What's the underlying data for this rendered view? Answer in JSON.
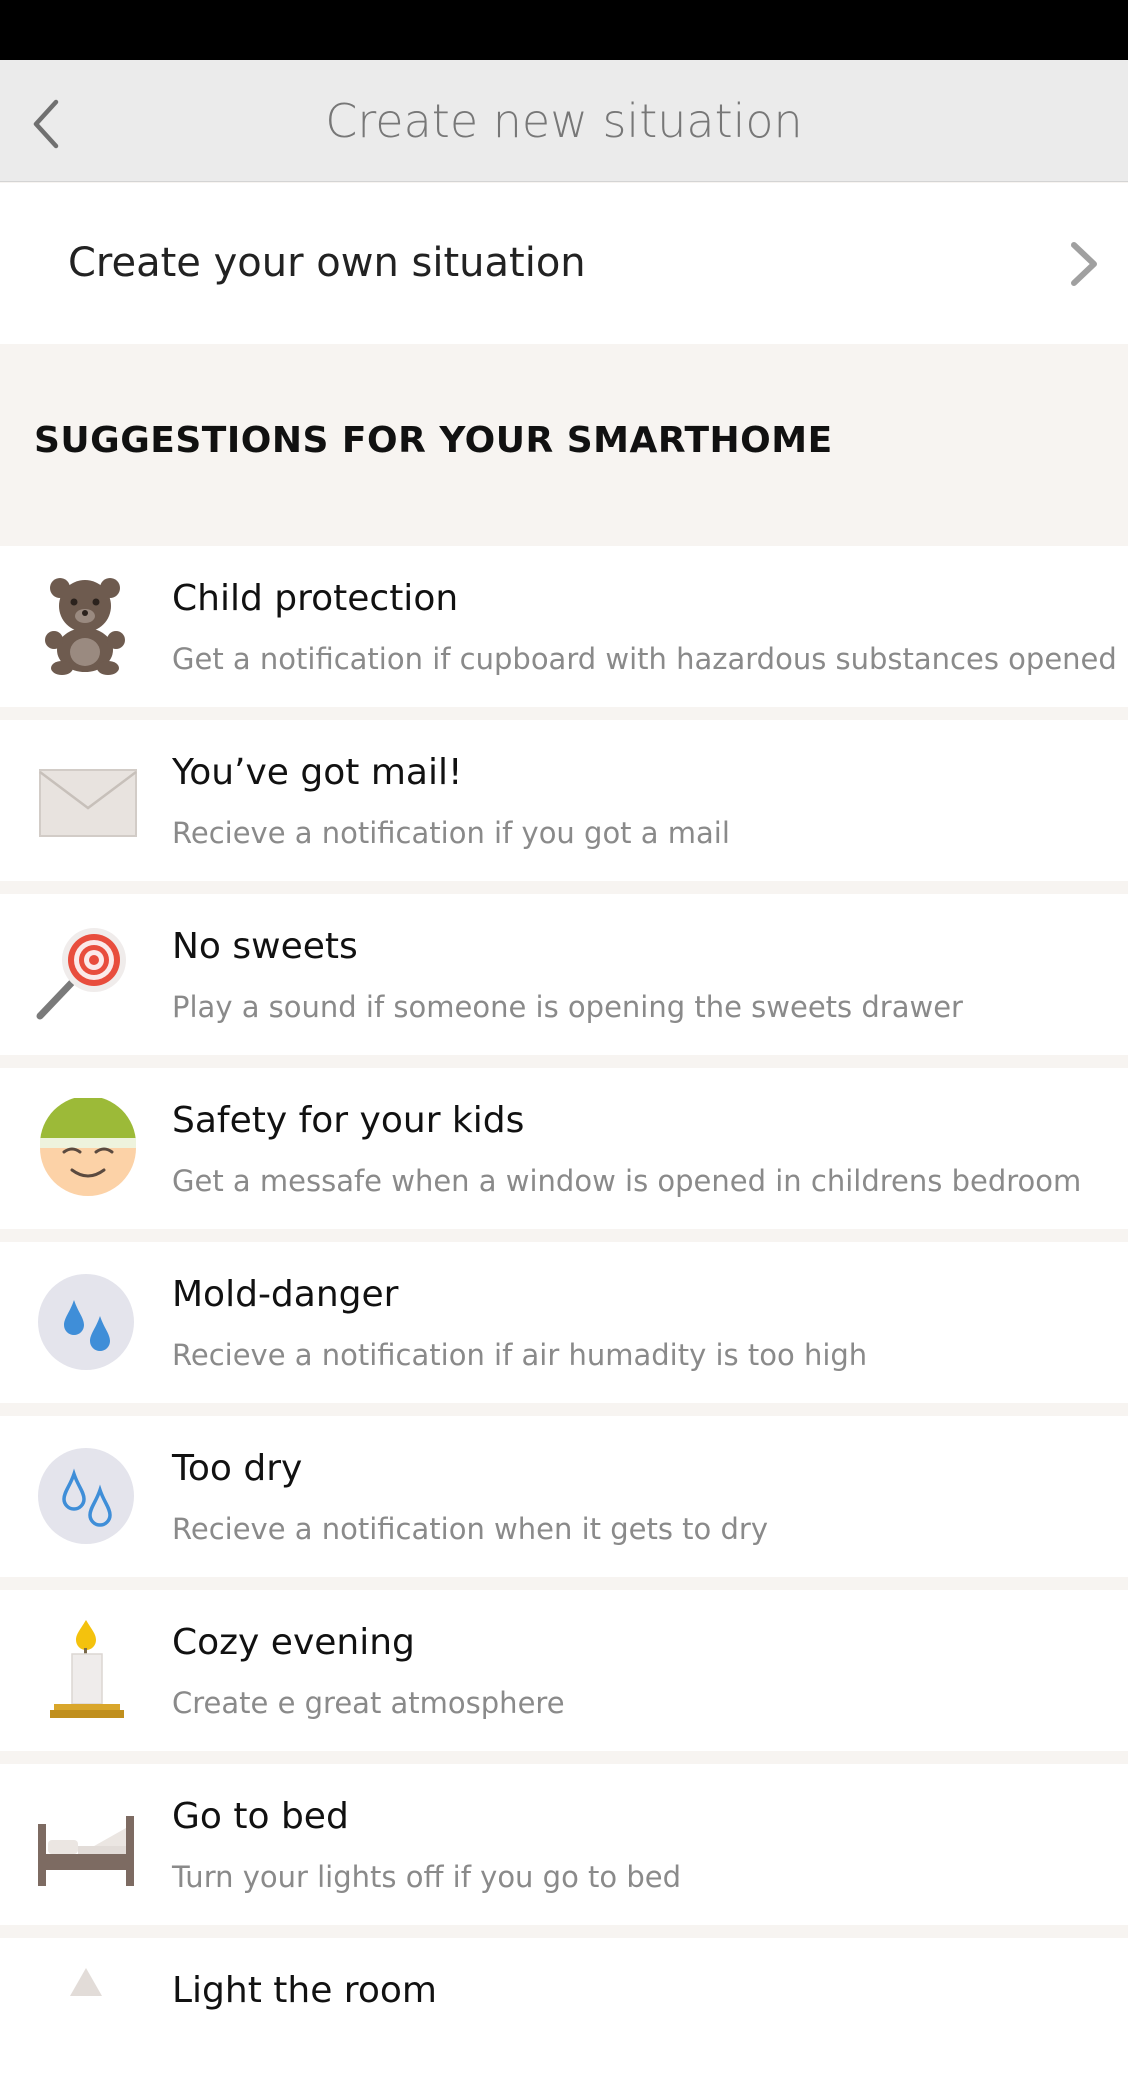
{
  "header": {
    "title": "Create new situation",
    "back_icon": "chevron-left-icon"
  },
  "own_situation": {
    "label": "Create your own situation",
    "chevron_icon": "chevron-right-icon"
  },
  "section": {
    "title": "SUGGESTIONS FOR YOUR SMARTHOME"
  },
  "suggestions": [
    {
      "title": "Child protection",
      "desc": "Get a notification if cupboard with hazardous substances opened",
      "icon": "teddy-bear-icon"
    },
    {
      "title": "You’ve got mail!",
      "desc": "Recieve a notification if you got a mail",
      "icon": "envelope-icon"
    },
    {
      "title": "No sweets",
      "desc": "Play a sound if someone is opening the sweets drawer",
      "icon": "lollipop-icon"
    },
    {
      "title": "Safety for your kids",
      "desc": "Get a messafe when a window is opened in childrens bedroom",
      "icon": "kid-face-icon"
    },
    {
      "title": "Mold-danger",
      "desc": "Recieve a notification if air humadity is too high",
      "icon": "water-drops-icon"
    },
    {
      "title": "Too dry",
      "desc": "Recieve a notification when it gets to dry",
      "icon": "empty-drops-icon"
    },
    {
      "title": "Cozy evening",
      "desc": "Create e great atmosphere",
      "icon": "candle-icon"
    },
    {
      "title": "Go to bed",
      "desc": "Turn your lights off if you go to bed",
      "icon": "bed-icon"
    },
    {
      "title": "Light the room",
      "desc": "",
      "icon": "lamp-icon"
    }
  ],
  "colors": {
    "header_bg": "#ebebeb",
    "section_bg": "#f7f4f1",
    "drop_blue": "#3f8ed8",
    "bear_brown": "#6e5b4f",
    "candle_flame": "#f4c20d"
  }
}
